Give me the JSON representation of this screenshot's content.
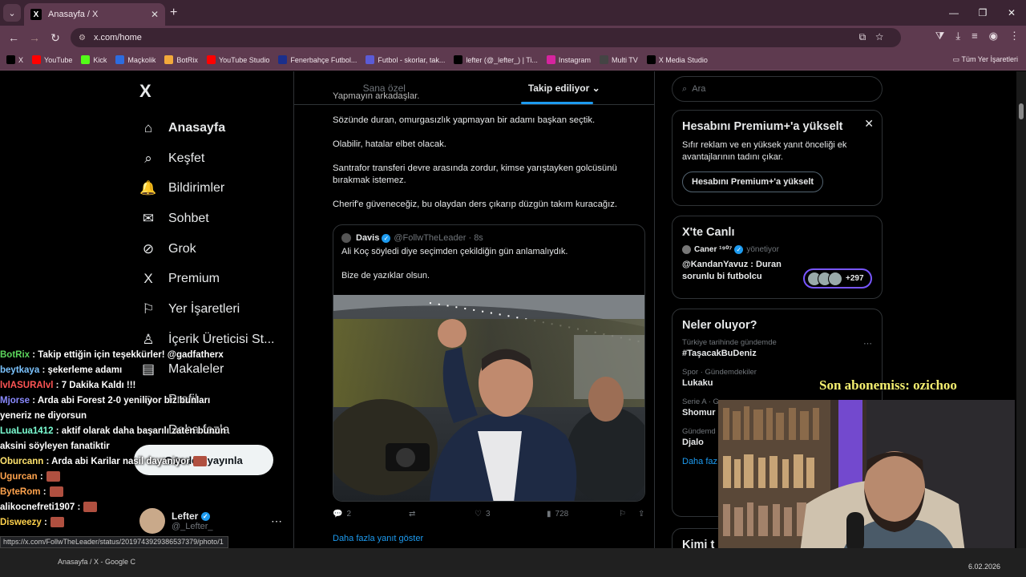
{
  "browser": {
    "tab_title": "Anasayfa / X",
    "tab_favicon": "X",
    "new_tab": "+",
    "url": "x.com/home",
    "bookmarks": [
      {
        "label": "X",
        "icon": "x-logo-icon",
        "color": "#000000"
      },
      {
        "label": "YouTube",
        "icon": "youtube-icon",
        "color": "#ff0000"
      },
      {
        "label": "Kick",
        "icon": "kick-icon",
        "color": "#53fc18"
      },
      {
        "label": "Maçkolik",
        "icon": "mackolik-icon",
        "color": "#2d6cdf"
      },
      {
        "label": "BotRix",
        "icon": "botrix-icon",
        "color": "#f2a93b"
      },
      {
        "label": "YouTube Studio",
        "icon": "youtube-icon",
        "color": "#ff0000"
      },
      {
        "label": "Fenerbahçe Futbol...",
        "icon": "fenerbahce-icon",
        "color": "#1b2f8c"
      },
      {
        "label": "Futbol - skorlar, tak...",
        "icon": "futbol-icon",
        "color": "#5b5bd6"
      },
      {
        "label": "lefter (@_lefter_) | Ti...",
        "icon": "tiktok-icon",
        "color": "#000000"
      },
      {
        "label": "Instagram",
        "icon": "instagram-icon",
        "color": "#d6249f"
      },
      {
        "label": "Multi TV",
        "icon": "multitv-icon",
        "color": "#444444"
      },
      {
        "label": "X Media Studio",
        "icon": "x-logo-icon",
        "color": "#000000"
      }
    ],
    "all_bookmarks": "Tüm Yer İşaretleri"
  },
  "sidebar": {
    "logo": "X",
    "items": [
      {
        "label": "Anasayfa",
        "icon": "home-icon",
        "glyph": "⌂"
      },
      {
        "label": "Keşfet",
        "icon": "search-icon",
        "glyph": "⌕"
      },
      {
        "label": "Bildirimler",
        "icon": "bell-icon",
        "glyph": "🔔"
      },
      {
        "label": "Sohbet",
        "icon": "mail-icon",
        "glyph": "✉"
      },
      {
        "label": "Grok",
        "icon": "grok-icon",
        "glyph": "⊘"
      },
      {
        "label": "Premium",
        "icon": "x-logo-icon",
        "glyph": "X"
      },
      {
        "label": "Yer İşaretleri",
        "icon": "bookmark-icon",
        "glyph": "⚐"
      },
      {
        "label": "İçerik Üreticisi St...",
        "icon": "creator-studio-icon",
        "glyph": "♙"
      },
      {
        "label": "Makaleler",
        "icon": "article-icon",
        "glyph": "▤"
      },
      {
        "label": "Profil",
        "icon": "profile-icon",
        "glyph": "☺"
      },
      {
        "label": "Daha fazla",
        "icon": "more-icon",
        "glyph": "⋯"
      }
    ],
    "post_button": "Gönderi yayınla",
    "account": {
      "name": "Lefter",
      "handle": "@_Lefter_"
    }
  },
  "feed": {
    "tabs": [
      "Sana özel",
      "Takip ediliyor"
    ],
    "tweet_lines": [
      "Yapmayın arkadaşlar.",
      "Sözünde duran, omurgasızlık yapmayan bir adamı başkan seçtik.",
      "Olabilir, hatalar elbet olacak.",
      "Santrafor transferi devre arasında zordur, kimse yarıştayken golcüsünü bırakmak istemez.",
      "Cherif'e güveneceğiz, bu olaydan ders çıkarıp düzgün takım kuracağız."
    ],
    "quote": {
      "name": "Davis",
      "handle": "@FollwTheLeader",
      "time": "· 8s",
      "lines": [
        "Ali Koç söyledi diye seçimden çekildiğin gün anlamalıydık.",
        "Bize de yazıklar olsun."
      ]
    },
    "actions": {
      "replies": "2",
      "likes": "3",
      "views": "728"
    },
    "show_more": "Daha fazla yanıt göster"
  },
  "right": {
    "search_placeholder": "Ara",
    "premium": {
      "title": "Hesabını Premium+'a yükselt",
      "text": "Sıfır reklam ve en yüksek yanıt önceliği ek avantajlarının tadını çıkar.",
      "button": "Hesabını Premium+'a yükselt"
    },
    "live": {
      "title": "X'te Canlı",
      "host": "Caner ¹⁹⁰⁷",
      "host_suffix": "yönetiyor",
      "space_title": "@KandanYavuz : Duran sorunlu bi futbolcu",
      "count": "+297"
    },
    "trends_title": "Neler oluyor?",
    "trends": [
      {
        "context": "Türkiye tarihinde gündemde",
        "name": "#TaşacakBuDeniz"
      },
      {
        "context": "Spor · Gündemdekiler",
        "name": "Lukaku"
      },
      {
        "context": "Serie A · G",
        "name": "Shomur"
      },
      {
        "context": "Gündemd",
        "name": "Djalo"
      }
    ],
    "show_more": "Daha faz",
    "who_to_follow": "Kimi t"
  },
  "overlay": {
    "subscriber_text": "Son abonemiss: ozichoo",
    "chat": [
      {
        "user": "BotRix",
        "msg": ": Takip ettiğin için teşekkürler! @gadfatherx",
        "color": "#5cd65c"
      },
      {
        "user": "beytkaya",
        "msg": ": şekerleme adamı",
        "color": "#7cc4ff"
      },
      {
        "user": "lvlASURAlvl",
        "msg": ": 7 Dakika Kaldı !!!",
        "color": "#ff5555"
      },
      {
        "user": "Mjorse",
        "msg": ": Arda abi Forest 2-0 yeniliyor biz bunları yeneriz ne diyorsun",
        "color": "#8a8aff"
      },
      {
        "user": "LuaLua1412",
        "msg": ": aktif olarak daha başarılı zaten bunun aksini söyleyen fanatiktir",
        "color": "#7cffd4"
      },
      {
        "user": "Oburcann",
        "msg": ": Arda abi Karilar nasil dayaniyor",
        "color": "#ffe36e"
      },
      {
        "user": "Ugurcan",
        "msg": ":",
        "color": "#ffa34d"
      },
      {
        "user": "ByteRom",
        "msg": ":",
        "color": "#ffa34d"
      },
      {
        "user": "alikocnefreti1907",
        "msg": ":",
        "color": "#ffffff"
      },
      {
        "user": "Disweezy",
        "msg": ":",
        "color": "#ffd24d"
      }
    ]
  },
  "status_url": "https://x.com/FollwTheLeader/status/2019743929386537379/photo/1",
  "taskbar": {
    "task": "Anasayfa / X - Google C",
    "date": "6.02.2026"
  },
  "colors": {
    "accent": "#1d9bf0",
    "chrome": "#5e3a4f",
    "space_ring": "#7856ff"
  }
}
